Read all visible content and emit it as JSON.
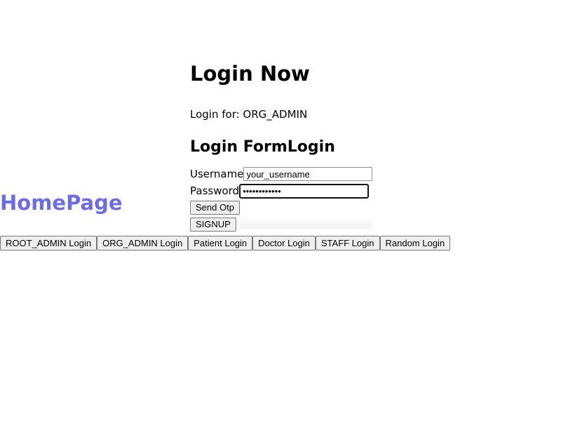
{
  "login": {
    "title": "Login Now",
    "login_for": "Login for: ORG_ADMIN",
    "form_title": "Login FormLogin",
    "username_label": "Username",
    "username_value": "your_username",
    "password_label": "Password",
    "password_value": "••••••••••••",
    "send_otp_label": "Send Otp",
    "signup_label": "SIGNUP"
  },
  "home": {
    "title": "HomePage",
    "title_color": "#6c6ce6"
  },
  "login_buttons": [
    {
      "label": "ROOT_ADMIN Login"
    },
    {
      "label": "ORG_ADMIN Login"
    },
    {
      "label": "Patient Login"
    },
    {
      "label": "Doctor Login"
    },
    {
      "label": "STAFF Login"
    },
    {
      "label": "Random Login"
    }
  ]
}
